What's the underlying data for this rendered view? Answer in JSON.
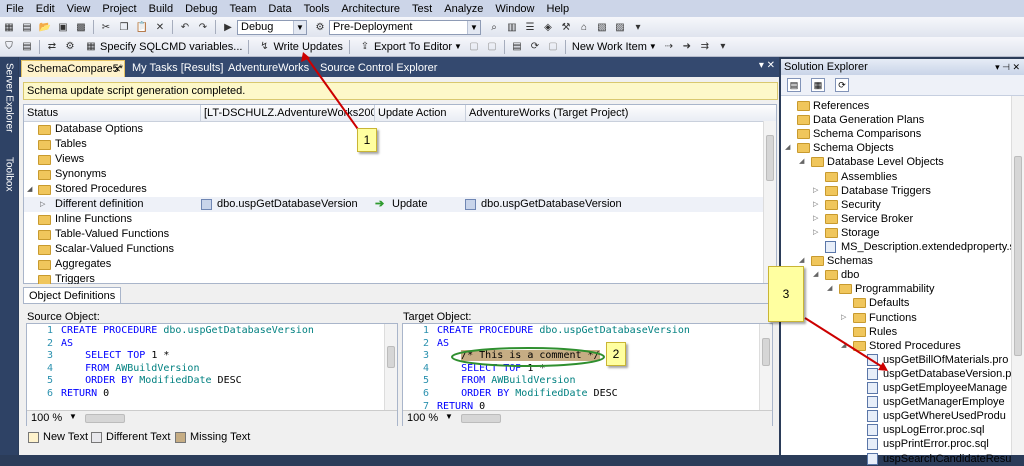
{
  "menu": [
    "File",
    "Edit",
    "View",
    "Project",
    "Build",
    "Debug",
    "Team",
    "Data",
    "Tools",
    "Architecture",
    "Test",
    "Analyze",
    "Window",
    "Help"
  ],
  "toolbar1": {
    "config_combo": "Debug",
    "deploy_combo": "Pre-Deployment"
  },
  "toolbar2": {
    "sqlcmd_label": "Specify SQLCMD variables...",
    "write_updates_label": "Write Updates",
    "export_label": "Export To Editor",
    "new_work_item_label": "New Work Item"
  },
  "left_strip": {
    "server_explorer": "Server Explorer",
    "toolbox": "Toolbox"
  },
  "doc_tabs": [
    "SchemaCompare5*",
    "My Tasks [Results]",
    "AdventureWorks",
    "Source Control Explorer"
  ],
  "info_message": "Schema update script generation completed.",
  "grid": {
    "headers": [
      "Status",
      "[LT-DSCHULZ.AdventureWorks2008R2...",
      "Update Action",
      "AdventureWorks (Target Project)"
    ],
    "rows": [
      {
        "label": "Database Options"
      },
      {
        "label": "Tables"
      },
      {
        "label": "Views"
      },
      {
        "label": "Synonyms"
      },
      {
        "label": "Stored Procedures"
      },
      {
        "label": "Different definition",
        "source": "dbo.uspGetDatabaseVersion",
        "action": "Update",
        "target": "dbo.uspGetDatabaseVersion"
      },
      {
        "label": "Inline Functions"
      },
      {
        "label": "Table-Valued Functions"
      },
      {
        "label": "Scalar-Valued Functions"
      },
      {
        "label": "Aggregates"
      },
      {
        "label": "Triggers"
      }
    ]
  },
  "object_definitions": {
    "tab_label": "Object Definitions",
    "source_label": "Source Object:",
    "target_label": "Target Object:",
    "source_lines": [
      {
        "n": "1",
        "kw": "CREATE PROCEDURE ",
        "obj": "dbo.uspGetDatabaseVersion",
        "rest": ""
      },
      {
        "n": "2",
        "kw": "AS",
        "obj": "",
        "rest": ""
      },
      {
        "n": "3",
        "kw": "    SELECT TOP ",
        "obj": "",
        "rest": "1 *"
      },
      {
        "n": "4",
        "kw": "    FROM ",
        "obj": "AWBuildVersion",
        "rest": ""
      },
      {
        "n": "5",
        "kw": "    ORDER BY ",
        "obj": "ModifiedDate",
        "rest": " DESC"
      },
      {
        "n": "6",
        "kw": "RETURN ",
        "obj": "",
        "rest": "0"
      }
    ],
    "target_lines": [
      {
        "n": "1",
        "kw": "CREATE PROCEDURE ",
        "obj": "dbo.uspGetDatabaseVersion",
        "rest": ""
      },
      {
        "n": "2",
        "kw": "AS",
        "obj": "",
        "rest": ""
      },
      {
        "n": "3",
        "kw": "    ",
        "obj": "",
        "rest": "/* This is a comment */"
      },
      {
        "n": "4",
        "kw": "    SELECT TOP ",
        "obj": "",
        "rest": "1 *"
      },
      {
        "n": "5",
        "kw": "    FROM ",
        "obj": "AWBuildVersion",
        "rest": ""
      },
      {
        "n": "6",
        "kw": "    ORDER BY ",
        "obj": "ModifiedDate",
        "rest": " DESC"
      },
      {
        "n": "7",
        "kw": "RETURN ",
        "obj": "",
        "rest": "0"
      }
    ],
    "zoom": "100 %"
  },
  "legend": [
    {
      "label": "New Text",
      "color": "#fff3cc"
    },
    {
      "label": "Different Text",
      "color": "#e8e8ec"
    },
    {
      "label": "Missing Text",
      "color": "#c6ad84"
    }
  ],
  "callouts": [
    "1",
    "2",
    "3"
  ],
  "solution_explorer": {
    "title": "Solution Explorer",
    "items": [
      {
        "label": "References",
        "level": 1,
        "type": "folder",
        "exp": ""
      },
      {
        "label": "Data Generation Plans",
        "level": 1,
        "type": "folder",
        "exp": ""
      },
      {
        "label": "Schema Comparisons",
        "level": 1,
        "type": "folder",
        "exp": ""
      },
      {
        "label": "Schema Objects",
        "level": 1,
        "type": "folder",
        "exp": "open"
      },
      {
        "label": "Database Level Objects",
        "level": 2,
        "type": "folder",
        "exp": "open"
      },
      {
        "label": "Assemblies",
        "level": 3,
        "type": "folder",
        "exp": ""
      },
      {
        "label": "Database Triggers",
        "level": 3,
        "type": "folder",
        "exp": "closed"
      },
      {
        "label": "Security",
        "level": 3,
        "type": "folder",
        "exp": "closed"
      },
      {
        "label": "Service Broker",
        "level": 3,
        "type": "folder",
        "exp": "closed"
      },
      {
        "label": "Storage",
        "level": 3,
        "type": "folder",
        "exp": "closed"
      },
      {
        "label": "MS_Description.extendedproperty.s",
        "level": 3,
        "type": "file",
        "exp": ""
      },
      {
        "label": "Schemas",
        "level": 2,
        "type": "folder",
        "exp": "open"
      },
      {
        "label": "dbo",
        "level": 3,
        "type": "folder",
        "exp": "open"
      },
      {
        "label": "Programmability",
        "level": 4,
        "type": "folder",
        "exp": "open"
      },
      {
        "label": "Defaults",
        "level": 5,
        "type": "folder",
        "exp": ""
      },
      {
        "label": "Functions",
        "level": 5,
        "type": "folder",
        "exp": "closed"
      },
      {
        "label": "Rules",
        "level": 5,
        "type": "folder",
        "exp": ""
      },
      {
        "label": "Stored Procedures",
        "level": 5,
        "type": "folder",
        "exp": "open"
      },
      {
        "label": "uspGetBillOfMaterials.pro",
        "level": 6,
        "type": "file",
        "exp": ""
      },
      {
        "label": "uspGetDatabaseVersion.p",
        "level": 6,
        "type": "file",
        "exp": ""
      },
      {
        "label": "uspGetEmployeeManage",
        "level": 6,
        "type": "file",
        "exp": ""
      },
      {
        "label": "uspGetManagerEmploye",
        "level": 6,
        "type": "file",
        "exp": ""
      },
      {
        "label": "uspGetWhereUsedProdu",
        "level": 6,
        "type": "file",
        "exp": ""
      },
      {
        "label": "uspLogError.proc.sql",
        "level": 6,
        "type": "file",
        "exp": ""
      },
      {
        "label": "uspPrintError.proc.sql",
        "level": 6,
        "type": "file",
        "exp": ""
      },
      {
        "label": "uspSearchCandidateResu",
        "level": 6,
        "type": "file",
        "exp": ""
      }
    ]
  },
  "colors": {
    "accent_tab": "#fff3cc",
    "arrow": "#cc0000",
    "comment_ellipse": "#2f8f2f"
  }
}
